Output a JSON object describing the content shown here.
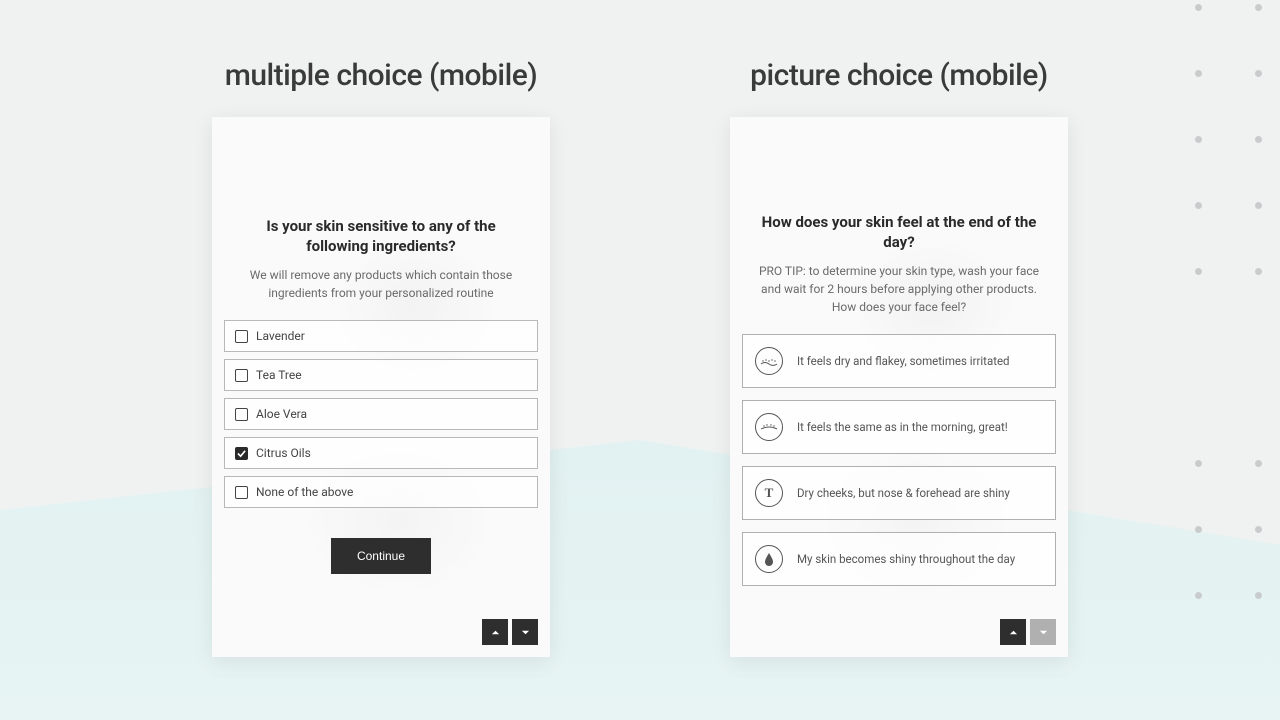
{
  "left": {
    "heading": "multiple choice (mobile)",
    "question": "Is your skin sensitive to any of the following ingredients?",
    "subtext": "We will remove any products which contain those ingredients from your personalized routine",
    "options": [
      {
        "label": "Lavender",
        "checked": false
      },
      {
        "label": "Tea Tree",
        "checked": false
      },
      {
        "label": "Aloe Vera",
        "checked": false
      },
      {
        "label": "Citrus Oils",
        "checked": true
      },
      {
        "label": "None of the above",
        "checked": false
      }
    ],
    "continue_label": "Continue"
  },
  "right": {
    "heading": "picture choice (mobile)",
    "question": "How does your skin feel at the end of the day?",
    "subtext": "PRO TIP: to determine your skin type, wash your face and wait for 2 hours before applying other products. How does your face feel?",
    "options": [
      {
        "label": "It feels dry and flakey, sometimes irritated",
        "icon": "dry"
      },
      {
        "label": "It feels the same as in the morning, great!",
        "icon": "normal"
      },
      {
        "label": "Dry cheeks, but nose & forehead are shiny",
        "icon": "tzone"
      },
      {
        "label": "My skin becomes shiny throughout the day",
        "icon": "oily"
      }
    ]
  }
}
